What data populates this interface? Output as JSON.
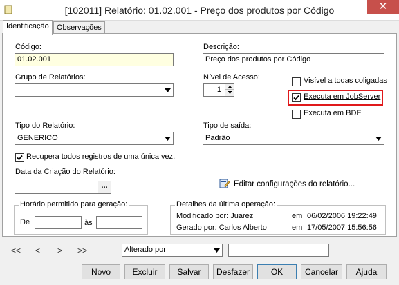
{
  "window": {
    "title": "[102011]  Relatório: 01.02.001 - Preço dos produtos por Código",
    "close_glyph": "✕"
  },
  "tabs": [
    {
      "label": "Identificação"
    },
    {
      "label": "Observações"
    }
  ],
  "form": {
    "codigo_label": "Código:",
    "codigo_value": "01.02.001",
    "descricao_label": "Descrição:",
    "descricao_value": "Preço dos produtos por Código",
    "grupo_label": "Grupo de Relatórios:",
    "grupo_value": "",
    "nivel_label": "Nível de Acesso:",
    "nivel_value": "1",
    "visivel_label": "Visível a todas coligadas",
    "visivel_checked": false,
    "jobserver_label": "Executa em JobServer",
    "jobserver_checked": true,
    "bde_label": "Executa em BDE",
    "bde_checked": false,
    "tipo_relatorio_label": "Tipo do Relatório:",
    "tipo_relatorio_value": "GENERICO",
    "tipo_saida_label": "Tipo de saída:",
    "tipo_saida_value": "Padrão",
    "recupera_label": "Recupera todos registros de uma única vez.",
    "recupera_checked": true,
    "data_criacao_label": "Data da Criação do Relatório:",
    "data_criacao_value": "",
    "ellipsis": "...",
    "editar_config_label": "Editar configurações do relatório...",
    "horario_title": "Horário permitido para geração:",
    "de_label": "De",
    "as_label": "às",
    "de_value": "",
    "as_value": "",
    "detalhes_title": "Detalhes da última operação:",
    "modificado_por": "Modificado por: Juarez",
    "modificado_em": "em",
    "modificado_data": "06/02/2006 19:22:49",
    "gerado_por": "Gerado por: Carlos Alberto",
    "gerado_em": "em",
    "gerado_data": "17/05/2007 15:56:56"
  },
  "navigation": {
    "first": "<<",
    "prev": "<",
    "next": ">",
    "last": ">>",
    "sort_value": "Alterado por",
    "search_value": ""
  },
  "buttons": {
    "novo": "Novo",
    "excluir": "Excluir",
    "salvar": "Salvar",
    "desfazer": "Desfazer",
    "ok": "OK",
    "cancelar": "Cancelar",
    "ajuda": "Ajuda"
  },
  "colors": {
    "highlight_box": "#e0191b",
    "readonly_bg": "#ffffe1",
    "close_bg": "#c7504b"
  },
  "icons": [
    "app-report-icon",
    "chevron-down-icon",
    "spin-up-icon",
    "spin-down-icon",
    "checkmark-icon",
    "config-edit-icon",
    "ellipsis-icon",
    "close-icon"
  ]
}
